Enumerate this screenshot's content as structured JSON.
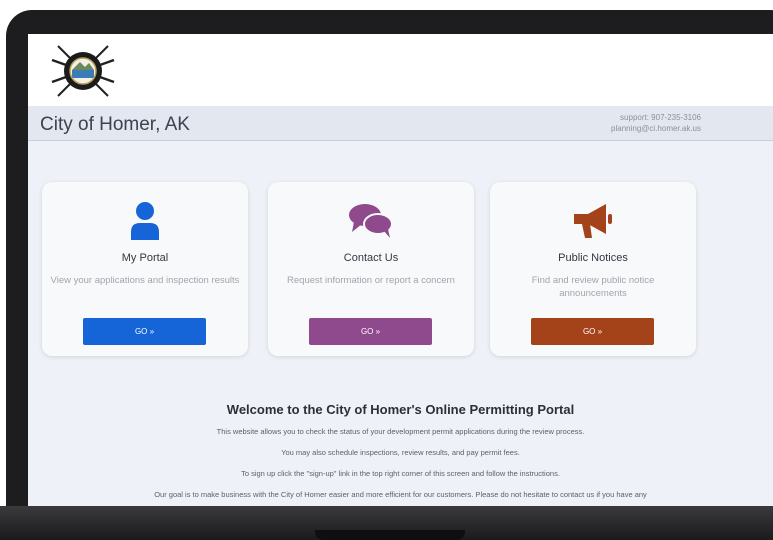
{
  "header": {
    "city_title": "City of Homer, AK",
    "support_line": "support: 907-235-3106",
    "email_line": "planning@ci.homer.ak.us"
  },
  "cards": [
    {
      "title": "My Portal",
      "description": "View your applications and inspection results",
      "button_label": "GO »",
      "icon": "person-icon",
      "color": "#1565d8"
    },
    {
      "title": "Contact Us",
      "description": "Request information or report a concern",
      "button_label": "GO »",
      "icon": "chat-bubbles-icon",
      "color": "#8e4a8c"
    },
    {
      "title": "Public Notices",
      "description": "Find and review public notice announcements",
      "button_label": "GO »",
      "icon": "megaphone-icon",
      "color": "#a4421a"
    }
  ],
  "welcome": {
    "title": "Welcome to the City of Homer's Online Permitting Portal",
    "lines": [
      "This website allows you to check the status of your development permit applications during the review process.",
      "You may also schedule inspections, review results, and pay permit fees.",
      "To sign up click the \"sign-up\" link in the top right corner of this screen and follow the instructions.",
      "Our goal is to make business with the City of Homer easier and more efficient for our customers. Please do not hesitate to contact us if you have any"
    ]
  },
  "colors": {
    "screen_bg": "#eef1f7",
    "header_bg": "#e3e8f0",
    "bezel": "#1d1d1f"
  }
}
